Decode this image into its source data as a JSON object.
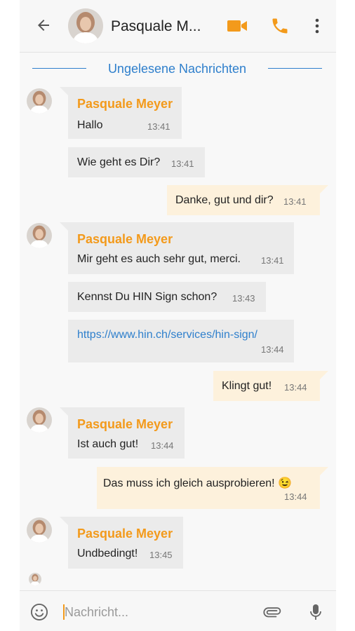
{
  "header": {
    "contact_name": "Pasquale M...",
    "back_icon": "arrow-left-icon",
    "video_icon": "video-camera-icon",
    "call_icon": "phone-icon",
    "more_icon": "more-vertical-icon"
  },
  "unread_divider": {
    "label": "Ungelesene Nachrichten"
  },
  "messages": [
    {
      "direction": "in",
      "sender": "Pasquale Meyer",
      "text": "Hallo",
      "time": "13:41"
    },
    {
      "direction": "in",
      "text": "Wie geht es Dir?",
      "time": "13:41"
    },
    {
      "direction": "out",
      "text": "Danke, gut und dir?",
      "time": "13:41"
    },
    {
      "direction": "in",
      "sender": "Pasquale Meyer",
      "text": "Mir geht es auch sehr gut, merci.",
      "time": "13:41"
    },
    {
      "direction": "in",
      "text": "Kennst Du HIN Sign schon?",
      "time": "13:43"
    },
    {
      "direction": "in",
      "text": "https://www.hin.ch/services/hin-sign/",
      "time": "13:44"
    },
    {
      "direction": "out",
      "text": "Klingt gut!",
      "time": "13:44"
    },
    {
      "direction": "in",
      "sender": "Pasquale Meyer",
      "text": "Ist auch gut!",
      "time": "13:44"
    },
    {
      "direction": "out",
      "text": "Das muss ich gleich ausprobieren! 😉",
      "time": "13:44"
    },
    {
      "direction": "in",
      "sender": "Pasquale Meyer",
      "text": "Undbedingt!",
      "time": "13:45"
    }
  ],
  "composer": {
    "placeholder": "Nachricht...",
    "emoji_icon": "emoji-icon",
    "attach_icon": "paperclip-icon",
    "mic_icon": "microphone-icon"
  },
  "colors": {
    "accent": "#f39a1b",
    "link": "#2e7fcc",
    "incoming_bubble": "#ebebeb",
    "outgoing_bubble": "#fdf1dc"
  }
}
